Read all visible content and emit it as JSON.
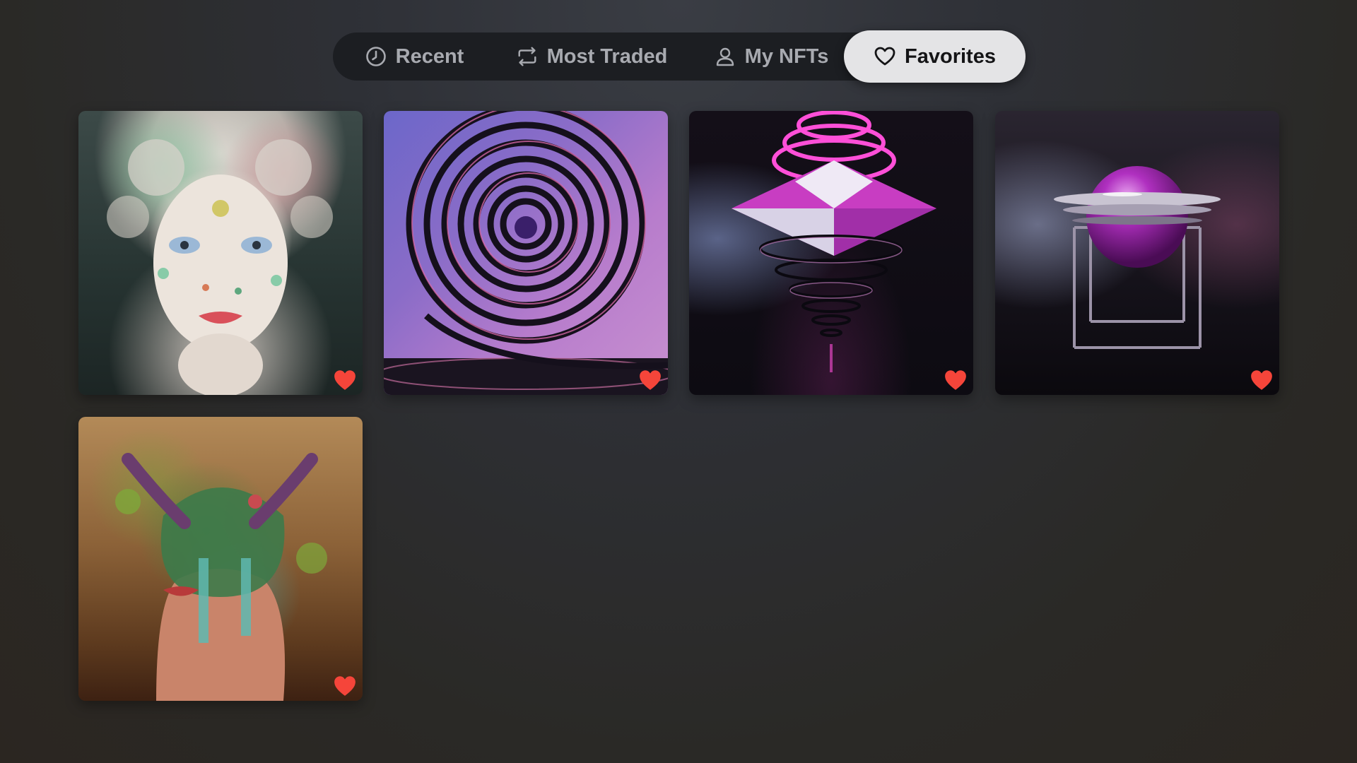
{
  "tabs": [
    {
      "id": "recent",
      "label": "Recent",
      "icon": "clock-icon",
      "active": false
    },
    {
      "id": "most-traded",
      "label": "Most Traded",
      "icon": "repeat-icon",
      "active": false
    },
    {
      "id": "my-nfts",
      "label": "My NFTs",
      "icon": "person-icon",
      "active": false
    },
    {
      "id": "favorites",
      "label": "Favorites",
      "icon": "heart-outline-icon",
      "active": true
    }
  ],
  "favorites": [
    {
      "art": "psychedelic-portrait",
      "favorited": true
    },
    {
      "art": "purple-spiral",
      "favorited": true
    },
    {
      "art": "neon-pyramid",
      "favorited": true
    },
    {
      "art": "purple-sphere-cage",
      "favorited": true
    },
    {
      "art": "jungle-face-love",
      "favorited": true
    }
  ],
  "colors": {
    "tabbar_bg": "#1c1e22",
    "active_tab_bg": "#e4e4e6",
    "inactive_tab_text": "#a8aab0",
    "active_tab_text": "#141416",
    "heart": "#f5453a"
  }
}
